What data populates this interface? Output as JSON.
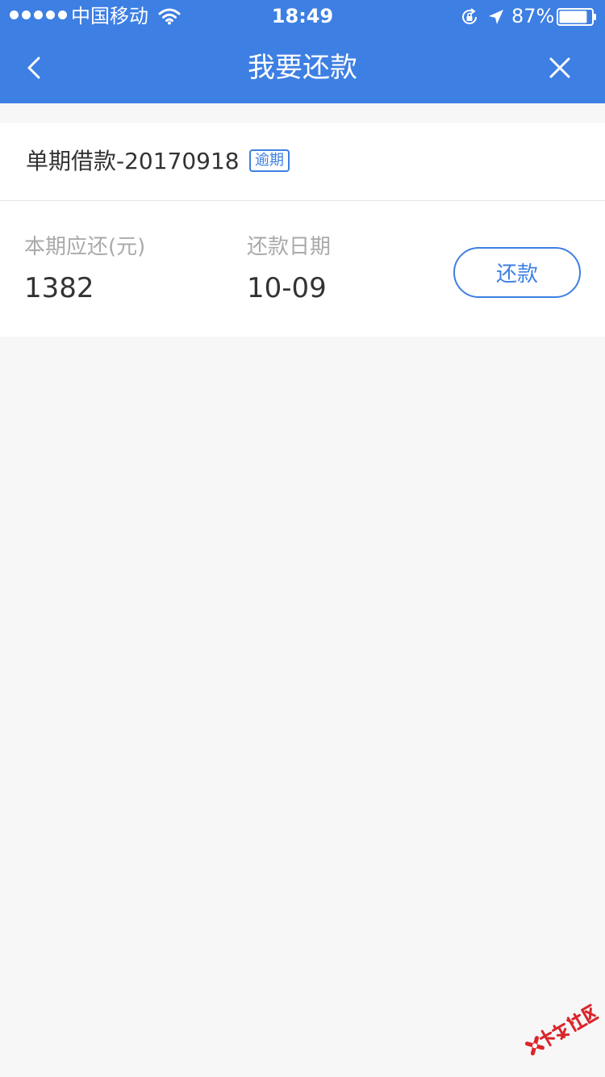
{
  "status_bar": {
    "carrier": "中国移动",
    "time": "18:49",
    "battery_percent": "87%",
    "battery_level": 0.87,
    "icons": [
      "signal-dots-icon",
      "wifi-icon",
      "rotation-lock-icon",
      "location-arrow-icon",
      "battery-icon"
    ]
  },
  "nav": {
    "title": "我要还款",
    "back_icon": "chevron-left-icon",
    "close_icon": "close-icon"
  },
  "loan": {
    "name": "单期借款-20170918",
    "badge": "逾期",
    "amount_label": "本期应还(元)",
    "amount_value": "1382",
    "date_label": "还款日期",
    "date_value": "10-09",
    "repay_button": "还款"
  },
  "watermark": {
    "logo": "kanong-logo",
    "text": "卡农社区"
  },
  "colors": {
    "brand": "#3d7fe3",
    "page_background": "#f7f7f8",
    "label_gray": "#aaaaaa",
    "text_dark": "#333333"
  }
}
